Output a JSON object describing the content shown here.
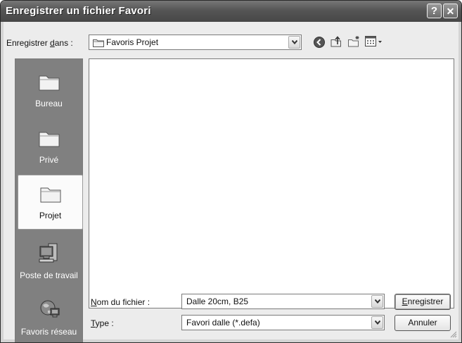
{
  "window": {
    "title": "Enregistrer un fichier Favori",
    "help_button": "?",
    "close_button": "✕"
  },
  "toolbar": {
    "save_in_label_pre": "Enregistrer ",
    "save_in_label_mnemonic": "d",
    "save_in_label_post": "ans :",
    "location": "Favoris Projet"
  },
  "places": [
    {
      "label": "Bureau",
      "icon": "folder-icon"
    },
    {
      "label": "Privé",
      "icon": "folder-icon"
    },
    {
      "label": "Projet",
      "icon": "folder-icon",
      "selected": true
    },
    {
      "label": "Poste de travail",
      "icon": "computer-icon"
    },
    {
      "label": "Favoris réseau",
      "icon": "network-icon"
    }
  ],
  "form": {
    "filename_label_mnemonic": "N",
    "filename_label_rest": "om du fichier :",
    "filename_value": "Dalle 20cm, B25",
    "type_label_mnemonic": "T",
    "type_label_rest": "ype :",
    "type_value": "Favori dalle (*.defa)"
  },
  "buttons": {
    "save_mnemonic": "E",
    "save_rest": "nregistrer",
    "cancel": "Annuler"
  }
}
